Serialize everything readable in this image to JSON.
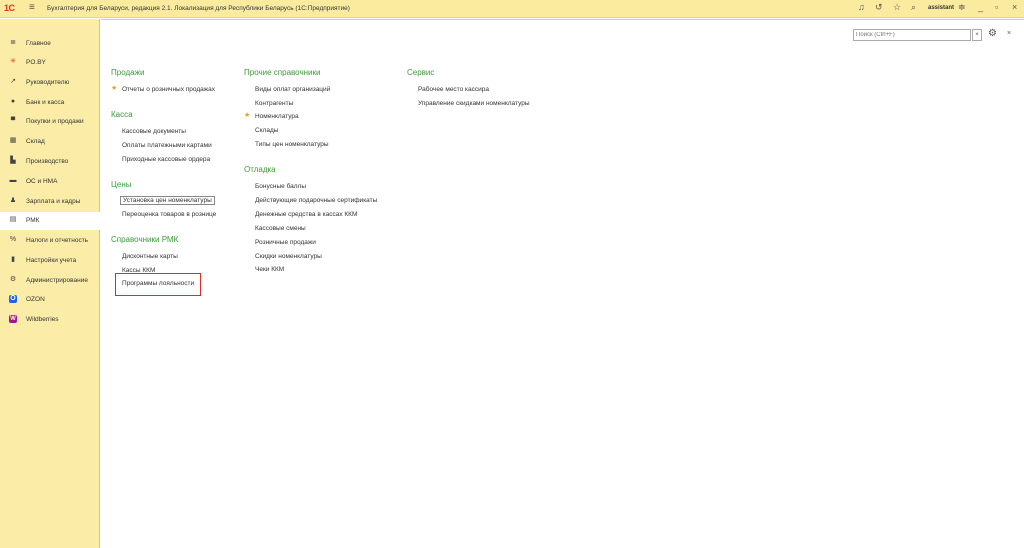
{
  "titlebar": {
    "logo": "1С",
    "title": "Бухгалтерия для Беларуси, редакция 2.1. Локализация для Республики Беларусь   (1С:Предприятие)",
    "user": "assistant"
  },
  "sidebar": {
    "items": [
      {
        "label": "Главное",
        "icon": "menu-lines-icon",
        "glyph": "≣"
      },
      {
        "label": "PO.BY",
        "icon": "asterisk-icon",
        "glyph": "✳"
      },
      {
        "label": "Руководителю",
        "icon": "trend-icon",
        "glyph": "↗"
      },
      {
        "label": "Банк и касса",
        "icon": "bank-icon",
        "glyph": "●"
      },
      {
        "label": "Покупки и продажи",
        "icon": "cart-icon",
        "glyph": "🛒"
      },
      {
        "label": "Склад",
        "icon": "warehouse-icon",
        "glyph": "▦"
      },
      {
        "label": "Производство",
        "icon": "factory-icon",
        "glyph": "▙"
      },
      {
        "label": "ОС и НМА",
        "icon": "truck-icon",
        "glyph": "▬"
      },
      {
        "label": "Зарплата и кадры",
        "icon": "person-icon",
        "glyph": "♟"
      },
      {
        "label": "РМК",
        "icon": "register-icon",
        "glyph": "▤"
      },
      {
        "label": "Налоги и отчетность",
        "icon": "percent-icon",
        "glyph": "%"
      },
      {
        "label": "Настройки учета",
        "icon": "book-icon",
        "glyph": "▮"
      },
      {
        "label": "Администрирование",
        "icon": "gear-icon",
        "glyph": "⚙"
      },
      {
        "label": "OZON",
        "icon": "ozon-icon",
        "glyph": "O"
      },
      {
        "label": "Wildberries",
        "icon": "wildberries-icon",
        "glyph": "W"
      }
    ],
    "active_index": 9
  },
  "main": {
    "search_placeholder": "Поиск (Ctrl+F)",
    "columns": {
      "col1": {
        "sales_title": "Продажи",
        "sales_items": [
          "Отчеты о розничных продажах"
        ],
        "kassa_title": "Касса",
        "kassa_items": [
          "Кассовые документы",
          "Оплаты платежными картами",
          "Приходные кассовые ордера"
        ],
        "prices_title": "Цены",
        "prices_items": [
          "Установка цен номенклатуры",
          "Переоценка товаров в рознице"
        ],
        "refs_title": "Справочники РМК",
        "refs_items": [
          "Дисконтные карты",
          "Кассы ККМ",
          "Программы лояльности"
        ]
      },
      "col2": {
        "other_title": "Прочие справочники",
        "other_items": [
          "Виды оплат организаций",
          "Контрагенты",
          "Номенклатура",
          "Склады",
          "Типы цен номенклатуры"
        ],
        "debug_title": "Отладка",
        "debug_items": [
          "Бонусные баллы",
          "Действующие подарочные сертификаты",
          "Денежные средства в кассах ККМ",
          "Кассовые смены",
          "Розничные продажи",
          "Скидки номенклатуры",
          "Чеки ККМ"
        ]
      },
      "col3": {
        "service_title": "Сервис",
        "service_items": [
          "Рабочее место кассира",
          "Управление скидками номенклатуры"
        ]
      }
    }
  }
}
